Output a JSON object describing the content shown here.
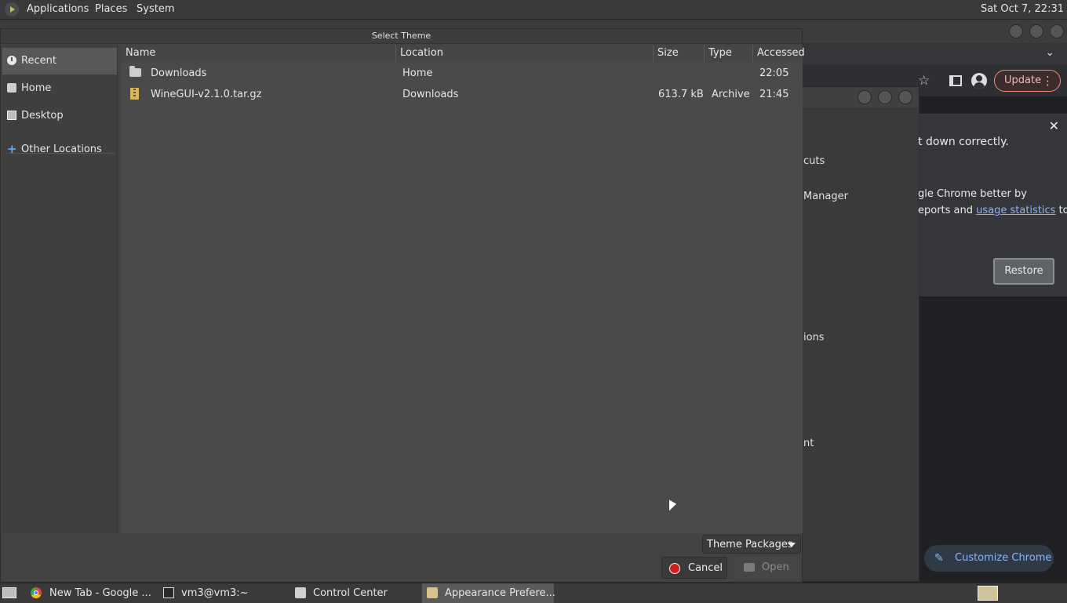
{
  "top_panel": {
    "menus": [
      "Applications",
      "Places",
      "System"
    ],
    "clock": "Sat Oct  7, 22:31"
  },
  "chrome": {
    "update_label": "Update",
    "update_dots": "⋮",
    "close_glyph": "✕",
    "chevron": "⌄",
    "star": "☆",
    "settings_fragments": [
      "cuts",
      "Manager",
      "ions",
      "nt"
    ],
    "infobar": {
      "line1": "t down correctly.",
      "line2": "gle Chrome better by",
      "line3_prefix": "eports and ",
      "line3_link": "usage statistics",
      "line3_suffix": " to",
      "restore": "Restore"
    },
    "customize_label": "Customize Chrome",
    "customize_icon": "✎"
  },
  "dialog": {
    "title": "Select Theme",
    "places": [
      {
        "label": "Recent",
        "icon": "clock-icon"
      },
      {
        "label": "Home",
        "icon": "home-icon"
      },
      {
        "label": "Desktop",
        "icon": "desktop-icon"
      },
      {
        "label": "Other Locations",
        "icon": "plus-icon"
      }
    ],
    "columns": [
      "Name",
      "Location",
      "Size",
      "Type",
      "Accessed"
    ],
    "rows": [
      {
        "name": "Downloads",
        "location": "Home",
        "size": "",
        "type": "",
        "accessed": "22:05",
        "icon": "folder-icon"
      },
      {
        "name": "WineGUI-v2.1.0.tar.gz",
        "location": "Downloads",
        "size": "613.7 kB",
        "type": "Archive",
        "accessed": "21:45",
        "icon": "archive-icon"
      }
    ],
    "filter": "Theme Packages",
    "cancel": "Cancel",
    "open": "Open"
  },
  "taskbar": {
    "tasks": [
      {
        "label": "New Tab - Google ...",
        "icon": "chrome-icon"
      },
      {
        "label": "vm3@vm3:~",
        "icon": "terminal-icon"
      },
      {
        "label": "Control Center",
        "icon": "control-center-icon"
      },
      {
        "label": "Appearance Prefere...",
        "icon": "appearance-icon"
      }
    ]
  }
}
